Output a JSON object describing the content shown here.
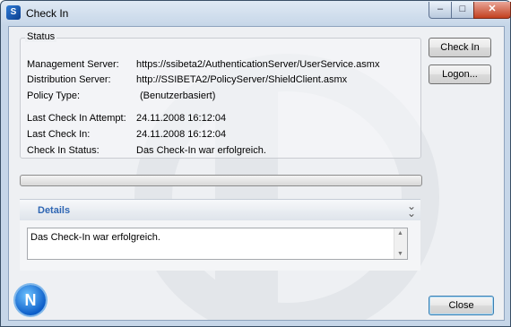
{
  "window": {
    "title": "Check In",
    "controls": {
      "minimize": "–",
      "maximize": "□",
      "close": "✕"
    }
  },
  "status": {
    "caption": "Status",
    "rows": [
      {
        "label": "Management Server:",
        "value": "https://ssibeta2/AuthenticationServer/UserService.asmx"
      },
      {
        "label": "Distribution Server:",
        "value": "http://SSIBETA2/PolicyServer/ShieldClient.asmx"
      },
      {
        "label": "Policy Type:",
        "value": "(Benutzerbasiert)"
      },
      {
        "label": "Last Check In Attempt:",
        "value": "24.11.2008 16:12:04"
      },
      {
        "label": "Last Check In:",
        "value": "24.11.2008 16:12:04"
      },
      {
        "label": "Check In Status:",
        "value": "Das Check-In war erfolgreich."
      }
    ]
  },
  "progress": {
    "value_percent": 0
  },
  "details": {
    "title": "Details",
    "text": "Das Check-In war erfolgreich."
  },
  "buttons": {
    "check_in": "Check In",
    "logon": "Logon...",
    "close": "Close"
  },
  "colors": {
    "details_title": "#2f66b3",
    "close_accent": "#3c7fb1"
  },
  "icons": {
    "app": "shield-app-icon",
    "logo": "n-logo-icon",
    "expand": "double-chevron-down-icon"
  }
}
